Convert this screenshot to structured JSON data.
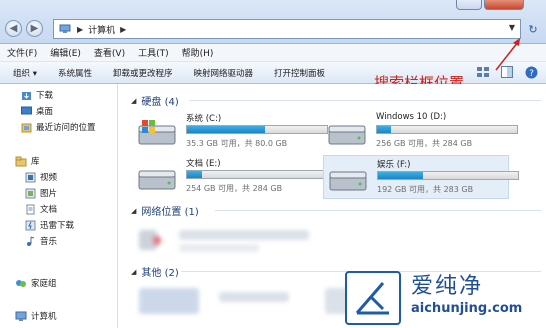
{
  "address": {
    "path": "计算机"
  },
  "menu": [
    "文件(F)",
    "编辑(E)",
    "查看(V)",
    "工具(T)",
    "帮助(H)"
  ],
  "toolbar": [
    "组织 ▾",
    "系统属性",
    "卸载或更改程序",
    "映射网络驱动器",
    "打开控制面板"
  ],
  "annotation": "搜索栏框位置",
  "sidebar": {
    "favorites": [
      "下载",
      "桌面",
      "最近访问的位置"
    ],
    "library_header": "库",
    "libraries": [
      "视频",
      "图片",
      "文档",
      "迅雷下载",
      "音乐"
    ],
    "homegroup": "家庭组",
    "computer": "计算机"
  },
  "groups": {
    "hdd": "硬盘 (4)",
    "network": "网络位置 (1)",
    "other": "其他 (2)"
  },
  "drives": [
    {
      "name": "系统 (C:)",
      "info": "35.3 GB 可用，共 80.0 GB",
      "used_fraction": 0.56
    },
    {
      "name": "Windows 10 (D:)",
      "info": "256 GB 可用，共 284 GB",
      "used_fraction": 0.1
    },
    {
      "name": "文档 (E:)",
      "info": "254 GB 可用，共 284 GB",
      "used_fraction": 0.11
    },
    {
      "name": "娱乐 (F:)",
      "info": "192 GB 可用，共 283 GB",
      "used_fraction": 0.32
    }
  ],
  "watermark": {
    "title": "爱纯净",
    "url": "aichunjing.com"
  },
  "colors": {
    "annotation": "#d0201a",
    "progress": "#1a84c7",
    "group_text": "#1e3f79"
  }
}
